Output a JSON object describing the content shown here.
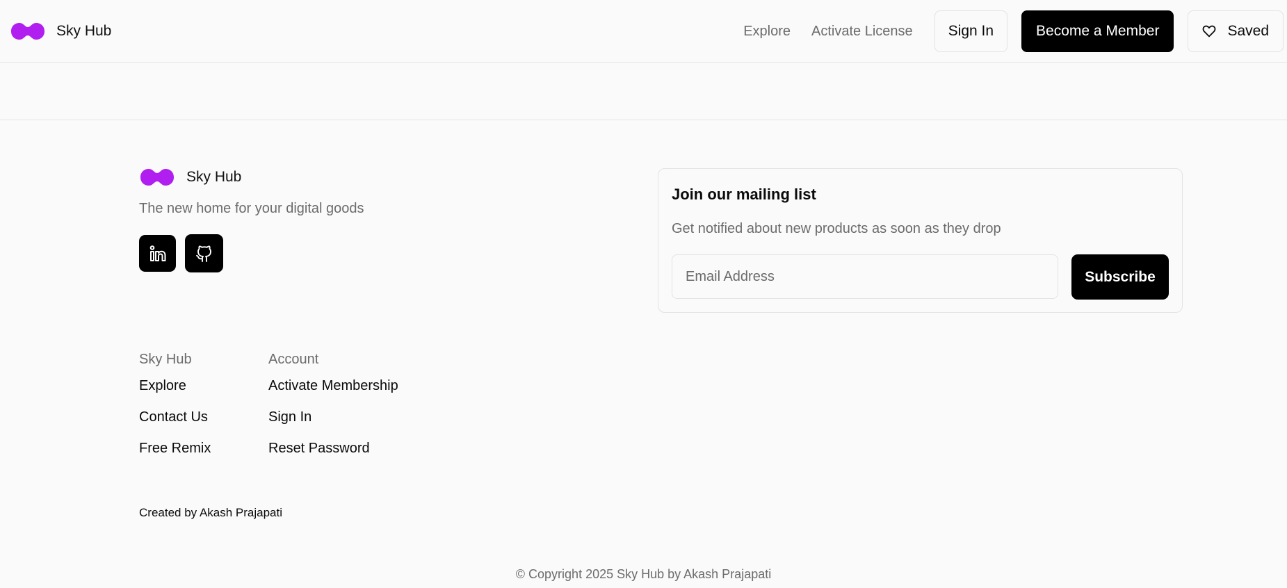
{
  "header": {
    "brand_name": "Sky Hub",
    "logo_color": "#b01ef0",
    "nav": {
      "explore": "Explore",
      "activate_license": "Activate License"
    },
    "sign_in": "Sign In",
    "become_member": "Become a Member",
    "saved": "Saved"
  },
  "footer": {
    "brand_name": "Sky Hub",
    "tagline": "The new home for your digital goods",
    "socials": [
      {
        "icon": "linkedin-icon"
      },
      {
        "icon": "github-icon"
      }
    ],
    "mailing": {
      "title": "Join our mailing list",
      "subtitle": "Get notified about new products as soon as they drop",
      "email_placeholder": "Email Address",
      "subscribe": "Subscribe"
    },
    "columns": [
      {
        "heading": "Sky Hub",
        "links": [
          "Explore",
          "Contact Us",
          "Free Remix"
        ]
      },
      {
        "heading": "Account",
        "links": [
          "Activate Membership",
          "Sign In",
          "Reset Password"
        ]
      }
    ],
    "created_by": "Created by Akash Prajapati",
    "copyright": "© Copyright 2025 Sky Hub by Akash Prajapati"
  }
}
